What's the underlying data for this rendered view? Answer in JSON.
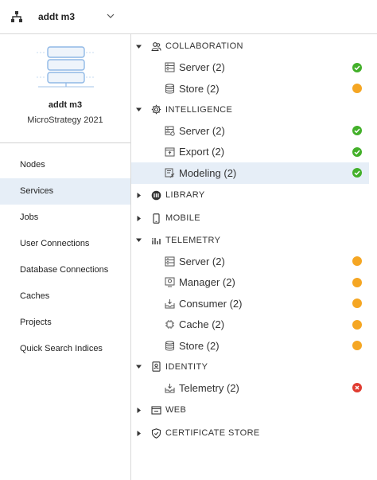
{
  "header": {
    "environment_name": "addt m3",
    "org_icon": "hierarchy-icon",
    "dropdown_icon": "chevron-down-icon"
  },
  "sidebar": {
    "environment_name": "addt m3",
    "version": "MicroStrategy 2021",
    "illustration": "server-stack-illustration",
    "items": [
      {
        "label": "Nodes"
      },
      {
        "label": "Services",
        "active": true
      },
      {
        "label": "Jobs"
      },
      {
        "label": "User Connections"
      },
      {
        "label": "Database Connections"
      },
      {
        "label": "Caches"
      },
      {
        "label": "Projects"
      },
      {
        "label": "Quick Search Indices"
      }
    ]
  },
  "colors": {
    "ok": "#43b02a",
    "warning": "#f5a623",
    "error": "#e03c31",
    "selected_bg": "#e6eef7"
  },
  "tree": {
    "collaboration": {
      "label": "COLLABORATION",
      "expanded": true,
      "children": [
        {
          "label": "Server (2)",
          "icon": "server-icon",
          "status": "ok"
        },
        {
          "label": "Store (2)",
          "icon": "database-icon",
          "status": "warning"
        }
      ]
    },
    "intelligence": {
      "label": "INTELLIGENCE",
      "expanded": true,
      "children": [
        {
          "label": "Server (2)",
          "icon": "server-gear-icon",
          "status": "ok"
        },
        {
          "label": "Export (2)",
          "icon": "export-icon",
          "status": "ok"
        },
        {
          "label": "Modeling (2)",
          "icon": "modeling-icon",
          "status": "ok",
          "selected": true
        }
      ]
    },
    "library": {
      "label": "LIBRARY",
      "expanded": false
    },
    "mobile": {
      "label": "MOBILE",
      "expanded": false
    },
    "telemetry": {
      "label": "TELEMETRY",
      "expanded": true,
      "children": [
        {
          "label": "Server (2)",
          "icon": "server-icon",
          "status": "warning"
        },
        {
          "label": "Manager (2)",
          "icon": "manager-icon",
          "status": "warning"
        },
        {
          "label": "Consumer (2)",
          "icon": "inbox-icon",
          "status": "warning"
        },
        {
          "label": "Cache (2)",
          "icon": "chip-icon",
          "status": "warning"
        },
        {
          "label": "Store (2)",
          "icon": "database-icon",
          "status": "warning"
        }
      ]
    },
    "identity": {
      "label": "IDENTITY",
      "expanded": true,
      "children": [
        {
          "label": "Telemetry (2)",
          "icon": "inbox-icon",
          "status": "error"
        }
      ]
    },
    "web": {
      "label": "WEB",
      "expanded": false
    },
    "certificate_store": {
      "label": "CERTIFICATE STORE",
      "expanded": false
    }
  }
}
